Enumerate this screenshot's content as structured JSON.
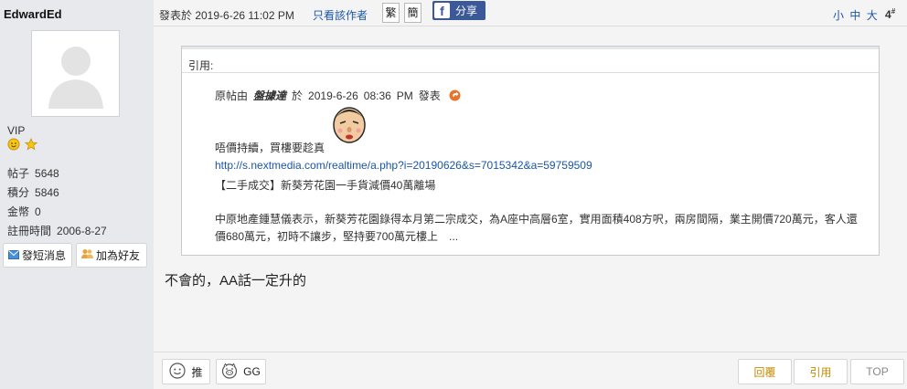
{
  "user": {
    "username": "EdwardEd",
    "rank": "VIP",
    "stats": [
      {
        "label": "帖子",
        "value": "5648"
      },
      {
        "label": "積分",
        "value": "5846"
      },
      {
        "label": "金幣",
        "value": "0"
      },
      {
        "label": "註冊時間",
        "value": "2006-8-27"
      }
    ],
    "send_message_label": "發短消息",
    "add_friend_label": "加為好友"
  },
  "post_header": {
    "posted_at": "發表於 2019-6-26 11:02 PM",
    "only_author_label": "只看該作者",
    "traditional_label": "繁",
    "simplified_label": "簡",
    "share_label": "分享",
    "font_small": "小",
    "font_medium": "中",
    "font_large": "大",
    "floor_number": "4",
    "floor_sup": "#"
  },
  "quote": {
    "header": "引用:",
    "original_prefix": "原帖由",
    "original_author": "盤據達",
    "at_label": "於",
    "original_date": "2019-6-26",
    "original_time": "08:36",
    "original_ampm": "PM",
    "posted_label": "發表",
    "line1": "唔價持續，買樓要趁真",
    "link": "http://s.nextmedia.com/realtime/a.php?i=20190626&s=7015342&a=59759509",
    "line2": "【二手成交】新葵芳花園一手貨減價40萬離場",
    "body": "中原地產鍾慧儀表示，新葵芳花園錄得本月第二宗成交，為A座中高層6室，實用面積408方呎，兩房間隔，業主開價720萬元，客人還價680萬元，初時不讓步，堅持要700萬元樓上　..."
  },
  "reply_text": "不會的，AA話一定升的",
  "actions": {
    "push_label": "推",
    "gg_label": "GG",
    "reply_label": "回覆",
    "quote_label": "引用",
    "top_label": "TOP"
  }
}
